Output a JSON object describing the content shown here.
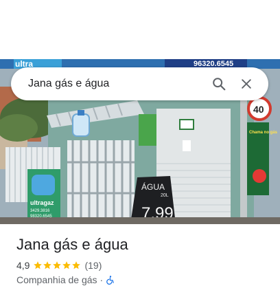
{
  "search": {
    "query": "Jana gás e água"
  },
  "photo_signs": {
    "phone_top": "96320.6545",
    "brand_top": "ultra",
    "left_brand": "ultragaz",
    "left_phone_1": "3429.3816",
    "left_phone_2": "98320.6545",
    "sign_agua": "ÁGUA",
    "sign_agua_sub": "20L",
    "sign_price": "7,99",
    "speed_limit": "40",
    "poster_text": "Chama no gás"
  },
  "place": {
    "name": "Jana gás e água",
    "rating": "4,9",
    "review_count": "(19)",
    "stars_filled": 5,
    "category": "Companhia de gás",
    "separator": "·"
  },
  "colors": {
    "star": "#fbbc04",
    "accessibility_icon": "#1a73e8",
    "text_primary": "#202124",
    "text_secondary": "#5f6368"
  },
  "icons": {
    "search": "search-icon",
    "close": "close-icon",
    "accessibility": "wheelchair-icon"
  }
}
